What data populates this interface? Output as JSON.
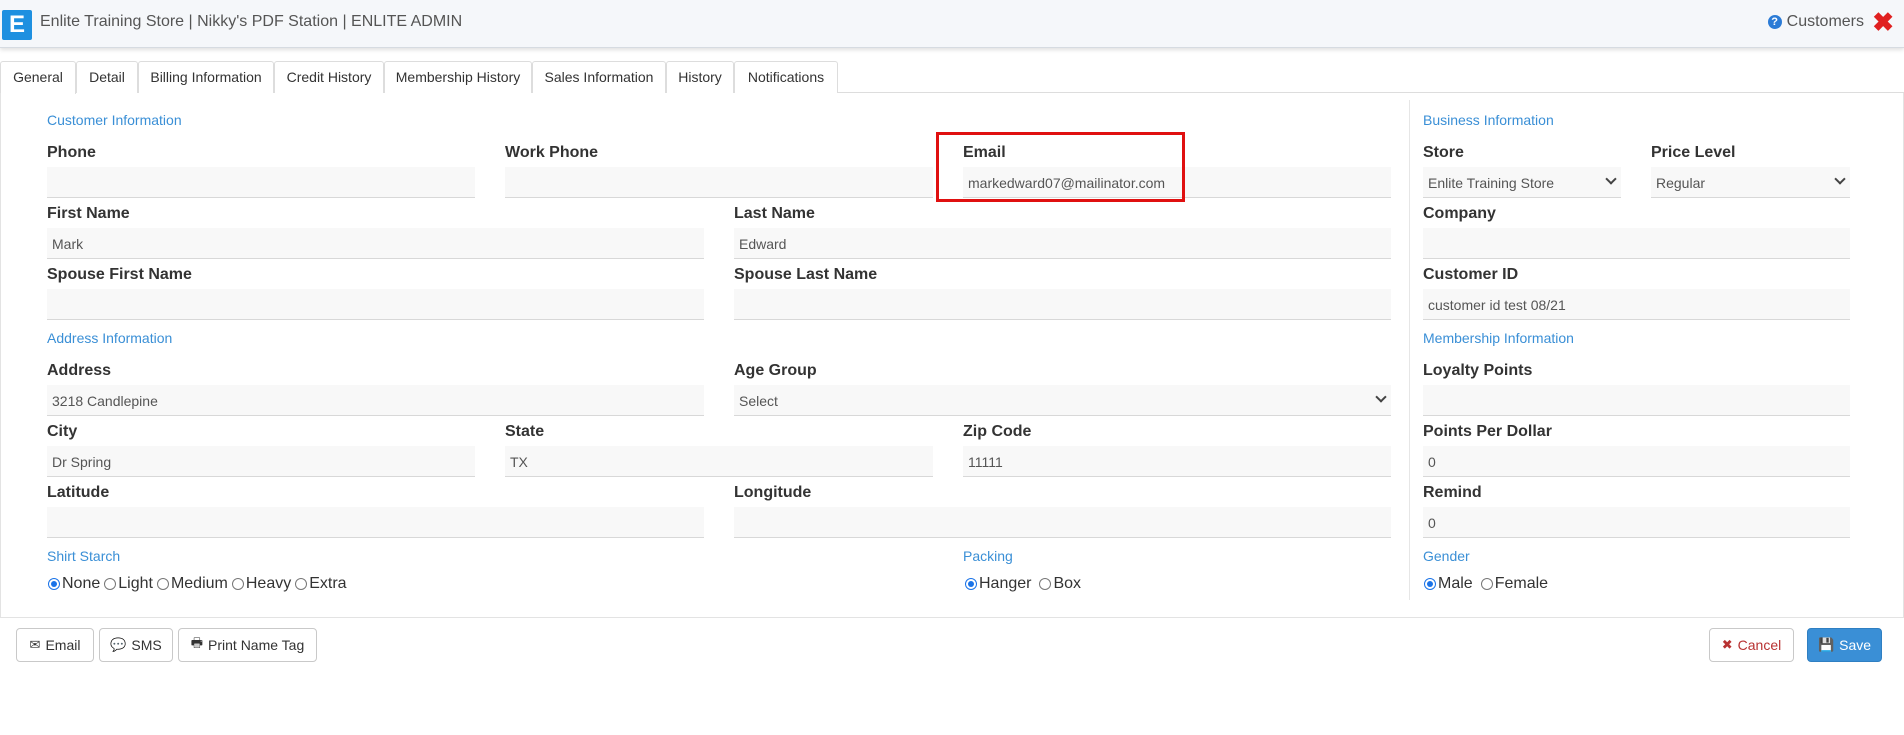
{
  "header": {
    "logo_letter": "E",
    "title": "Enlite Training Store | Nikky's PDF Station | ENLITE ADMIN",
    "help_label": "Customers",
    "close_glyph": "✖"
  },
  "tabs": [
    {
      "label": "General",
      "active": true
    },
    {
      "label": "Detail"
    },
    {
      "label": "Billing Information"
    },
    {
      "label": "Credit History"
    },
    {
      "label": "Membership History"
    },
    {
      "label": "Sales Information"
    },
    {
      "label": "History"
    },
    {
      "label": "Notifications"
    }
  ],
  "customer": {
    "section": "Customer Information",
    "phone_label": "Phone",
    "phone_value": "",
    "work_phone_label": "Work Phone",
    "work_phone_value": "",
    "email_label": "Email",
    "email_value": "markedward07@mailinator.com",
    "first_name_label": "First Name",
    "first_name_value": "Mark",
    "last_name_label": "Last Name",
    "last_name_value": "Edward",
    "spouse_first_label": "Spouse First Name",
    "spouse_first_value": "",
    "spouse_last_label": "Spouse Last Name",
    "spouse_last_value": ""
  },
  "address": {
    "section": "Address Information",
    "address_label": "Address",
    "address_value": "3218 Candlepine",
    "age_group_label": "Age Group",
    "age_group_value": "Select",
    "city_label": "City",
    "city_value": "Dr Spring",
    "state_label": "State",
    "state_value": "TX",
    "zip_label": "Zip Code",
    "zip_value": "11111",
    "latitude_label": "Latitude",
    "latitude_value": "",
    "longitude_label": "Longitude",
    "longitude_value": ""
  },
  "shirt_starch": {
    "section": "Shirt Starch",
    "options": [
      "None",
      "Light",
      "Medium",
      "Heavy",
      "Extra"
    ],
    "selected": "None"
  },
  "packing": {
    "section": "Packing",
    "options": [
      "Hanger",
      "Box"
    ],
    "selected": "Hanger"
  },
  "business": {
    "section": "Business Information",
    "store_label": "Store",
    "store_value": "Enlite Training Store",
    "price_level_label": "Price Level",
    "price_level_value": "Regular",
    "company_label": "Company",
    "company_value": "",
    "customer_id_label": "Customer ID",
    "customer_id_value": "customer id test 08/21"
  },
  "membership": {
    "section": "Membership Information",
    "loyalty_label": "Loyalty Points",
    "loyalty_value": "",
    "ppd_label": "Points Per Dollar",
    "ppd_value": "0",
    "remind_label": "Remind",
    "remind_value": "0"
  },
  "gender": {
    "section": "Gender",
    "options": [
      "Male",
      "Female"
    ],
    "selected": "Male"
  },
  "footer": {
    "email_btn": "Email",
    "sms_btn": "SMS",
    "print_btn": "Print Name Tag",
    "cancel_btn": "Cancel",
    "save_btn": "Save"
  },
  "colors": {
    "accent": "#3a8fd6",
    "highlight": "#e01010",
    "close": "#e02020"
  }
}
